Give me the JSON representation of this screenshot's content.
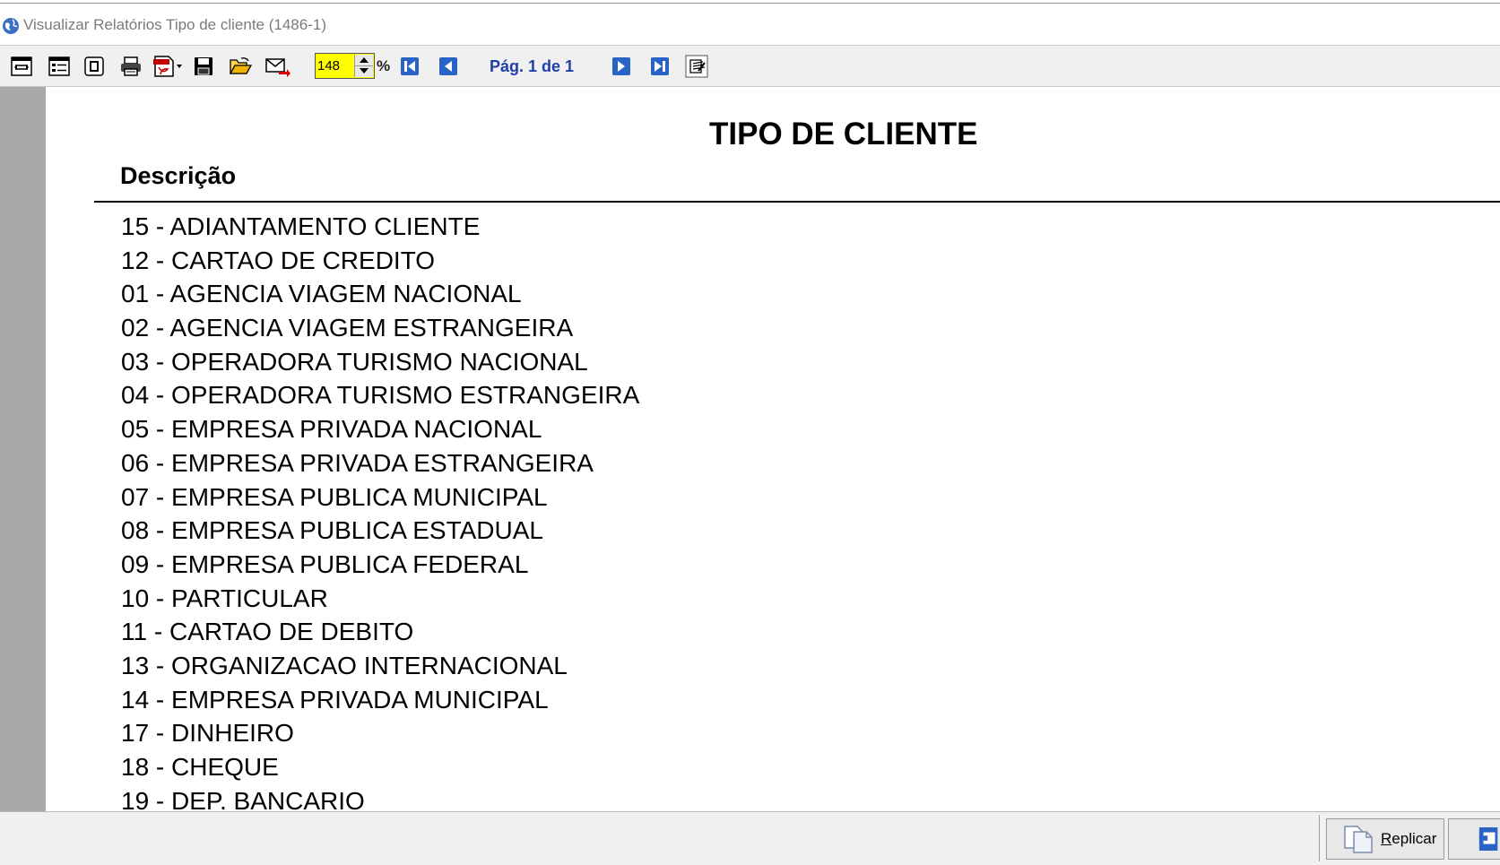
{
  "window": {
    "title": "Visualizar Relatórios Tipo de cliente (1486-1)"
  },
  "toolbar": {
    "zoom_value": "148",
    "zoom_unit": "%",
    "page_info": "Pág. 1 de 1"
  },
  "report": {
    "title": "TIPO DE CLIENTE",
    "column_header": "Descrição",
    "rows": [
      "15 - ADIANTAMENTO CLIENTE",
      "12 - CARTAO DE CREDITO",
      "01 - AGENCIA VIAGEM NACIONAL",
      "02 - AGENCIA VIAGEM ESTRANGEIRA",
      "03 - OPERADORA TURISMO NACIONAL",
      "04 - OPERADORA TURISMO ESTRANGEIRA",
      "05 - EMPRESA PRIVADA NACIONAL",
      "06 - EMPRESA PRIVADA ESTRANGEIRA",
      "07 - EMPRESA PUBLICA MUNICIPAL",
      "08 - EMPRESA PUBLICA ESTADUAL",
      "09 - EMPRESA PUBLICA FEDERAL",
      "10 - PARTICULAR",
      "11 - CARTAO DE DEBITO",
      "13 - ORGANIZACAO INTERNACIONAL",
      "14 - EMPRESA PRIVADA MUNICIPAL",
      "17 - DINHEIRO",
      "18 - CHEQUE",
      "19 - DEP. BANCARIO"
    ]
  },
  "footer": {
    "replicar_label_first": "R",
    "replicar_label_rest": "eplicar"
  },
  "icons": [
    "page-width-icon",
    "page-layout-icon",
    "single-page-icon",
    "print-icon",
    "export-pdf-icon",
    "save-icon",
    "open-folder-icon",
    "email-icon",
    "first-page-icon",
    "prev-page-icon",
    "next-page-icon",
    "last-page-icon",
    "settings-icon",
    "copy-icon",
    "exit-icon"
  ],
  "colors": {
    "accent_blue": "#1f3ea8",
    "zoom_highlight": "#ffff00"
  }
}
